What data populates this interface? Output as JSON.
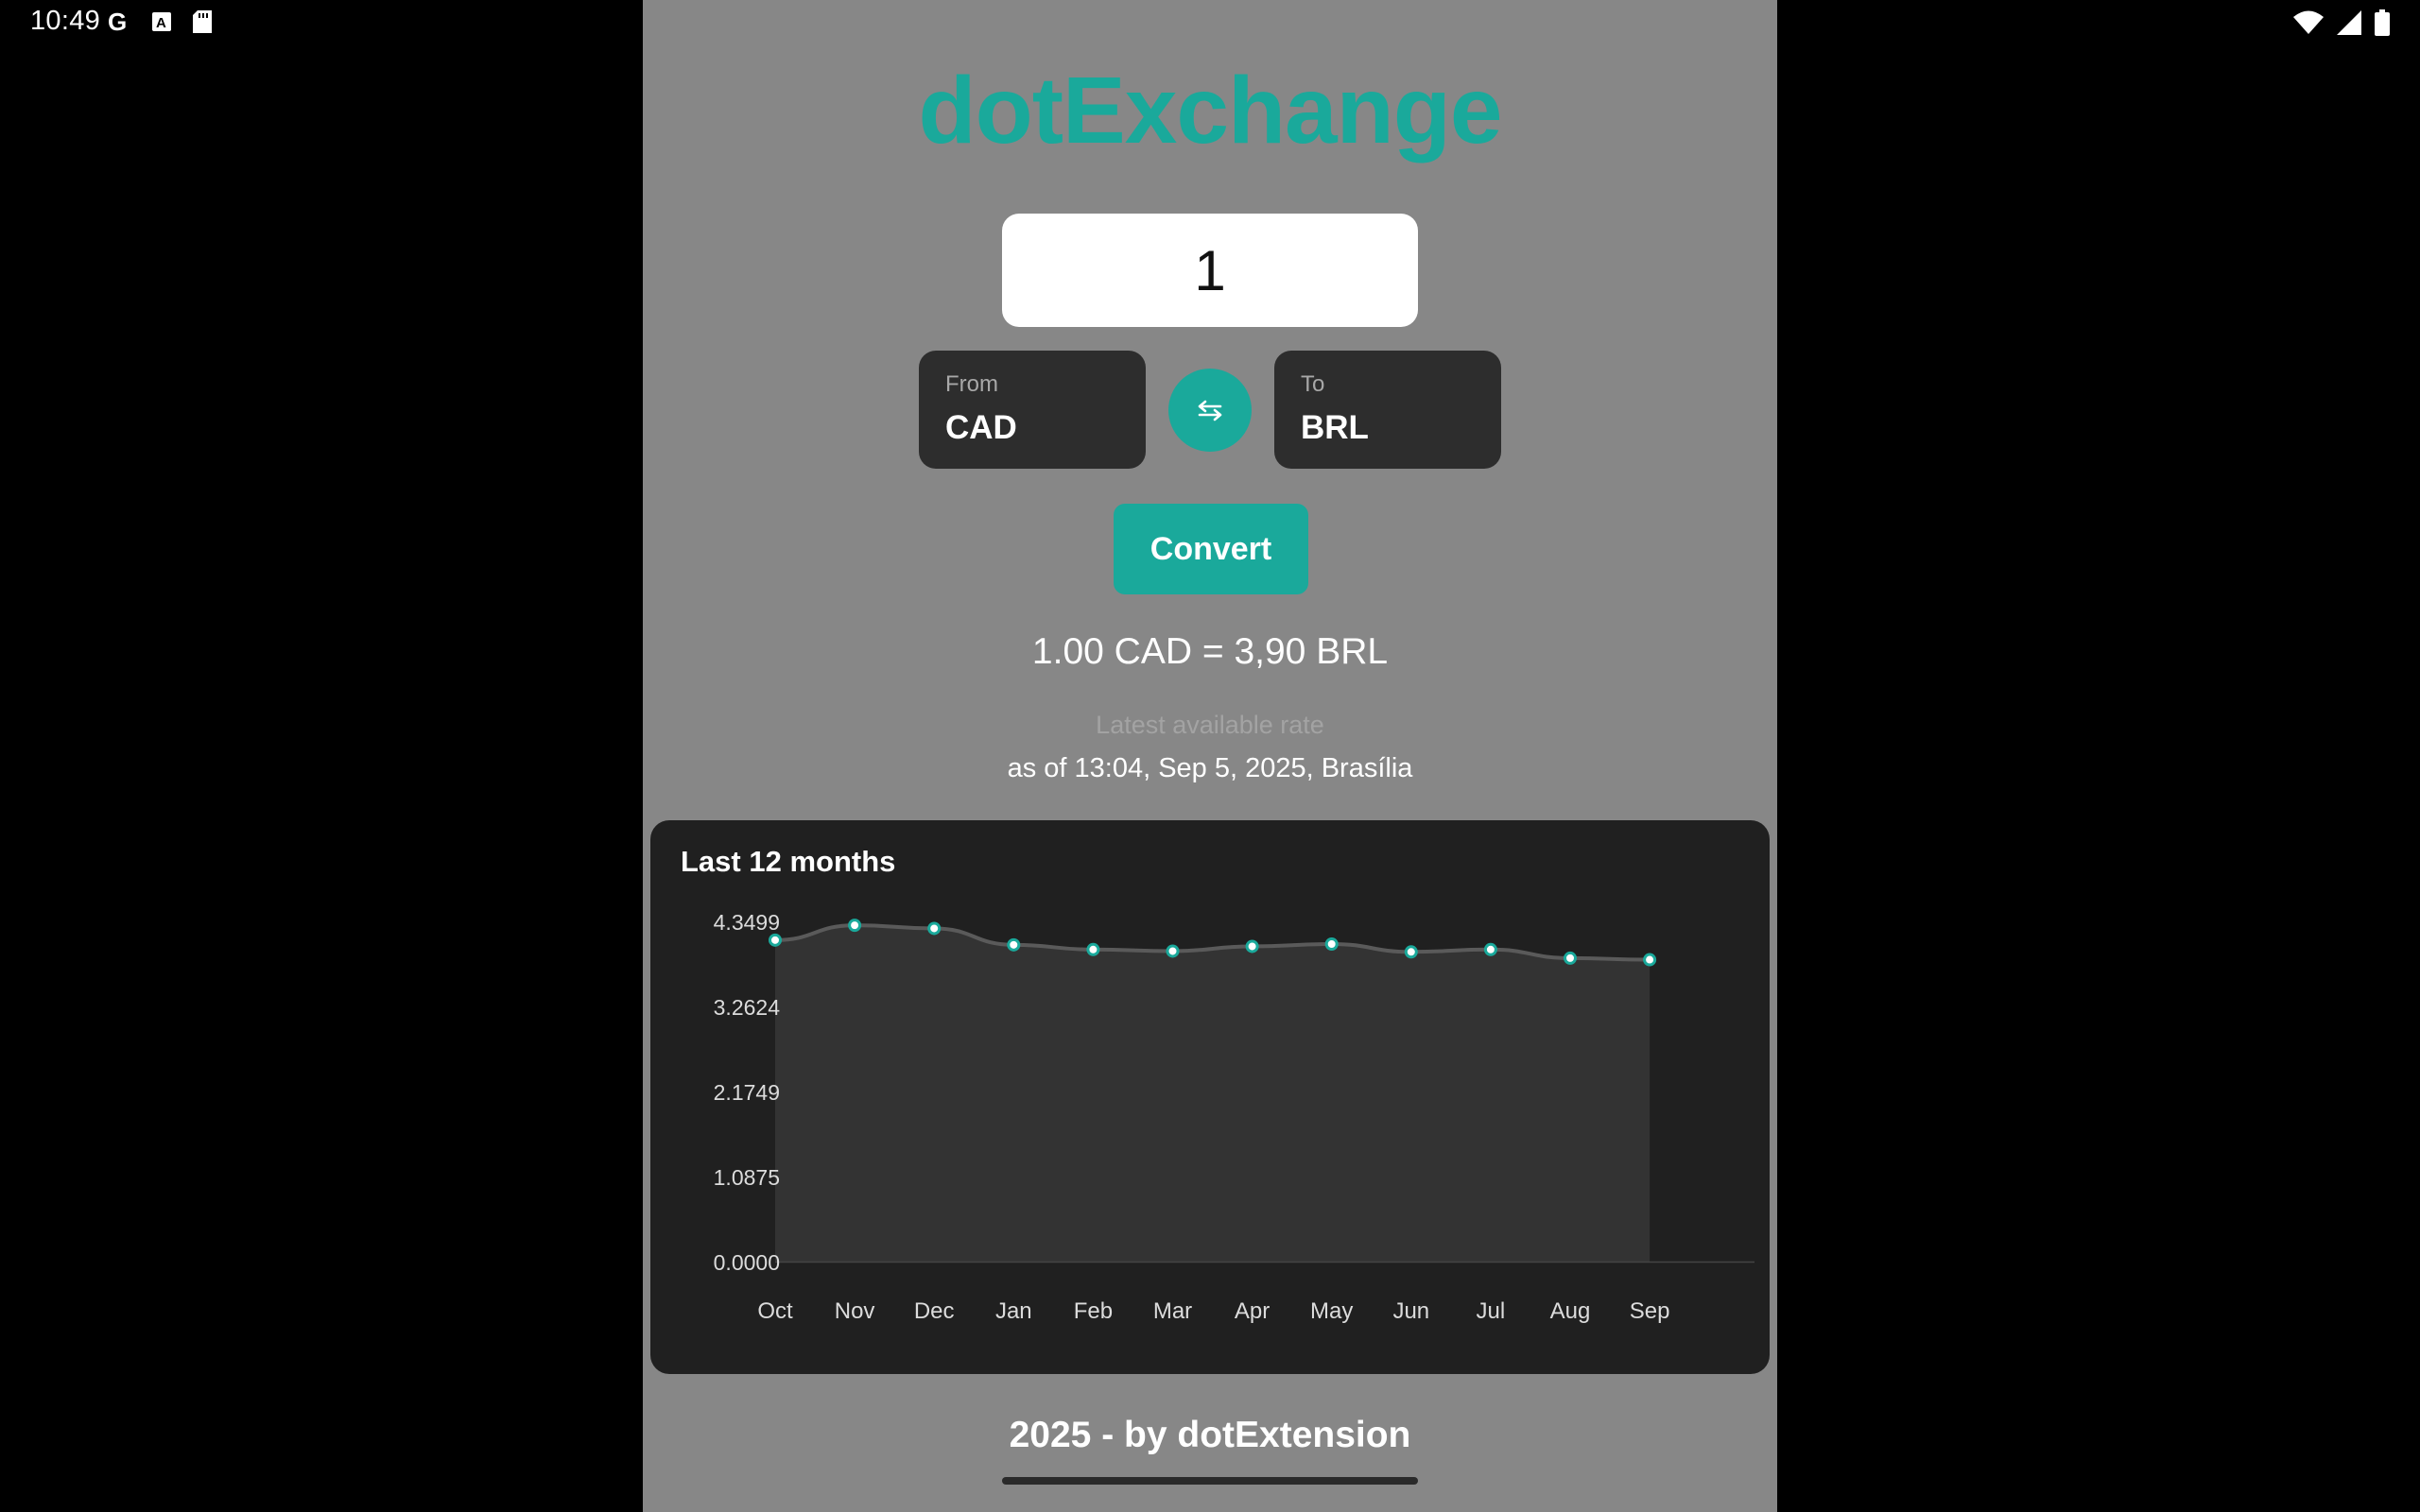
{
  "status_bar": {
    "time": "10:49",
    "left_icons": [
      "google-icon",
      "font-icon",
      "sd-card-icon"
    ],
    "right_icons": [
      "wifi-icon",
      "signal-icon",
      "battery-icon"
    ]
  },
  "app": {
    "brand": "dotExchange",
    "amount_value": "1",
    "from": {
      "label": "From",
      "value": "CAD"
    },
    "to": {
      "label": "To",
      "value": "BRL"
    },
    "swap_icon": "swap-icon",
    "convert_label": "Convert",
    "result": "1.00 CAD = 3,90 BRL",
    "rate_note": "Latest available rate",
    "rate_time": "as of 13:04, Sep 5, 2025, Brasília",
    "footer": "2025 - by dotExtension",
    "colors": {
      "accent": "#1aa99b",
      "background": "#878787",
      "card": "#202020",
      "field": "#2d2d2d"
    }
  },
  "chart_data": {
    "type": "area",
    "title": "Last 12 months",
    "categories": [
      "Oct",
      "Nov",
      "Dec",
      "Jan",
      "Feb",
      "Mar",
      "Apr",
      "May",
      "Jun",
      "Jul",
      "Aug",
      "Sep"
    ],
    "values": [
      4.11,
      4.3,
      4.26,
      4.05,
      3.99,
      3.97,
      4.03,
      4.06,
      3.96,
      3.99,
      3.88,
      3.86
    ],
    "y_ticks": [
      "0.0000",
      "1.0875",
      "2.1749",
      "3.2624",
      "4.3499"
    ],
    "ylim": [
      0,
      4.3499
    ],
    "grid": false
  }
}
